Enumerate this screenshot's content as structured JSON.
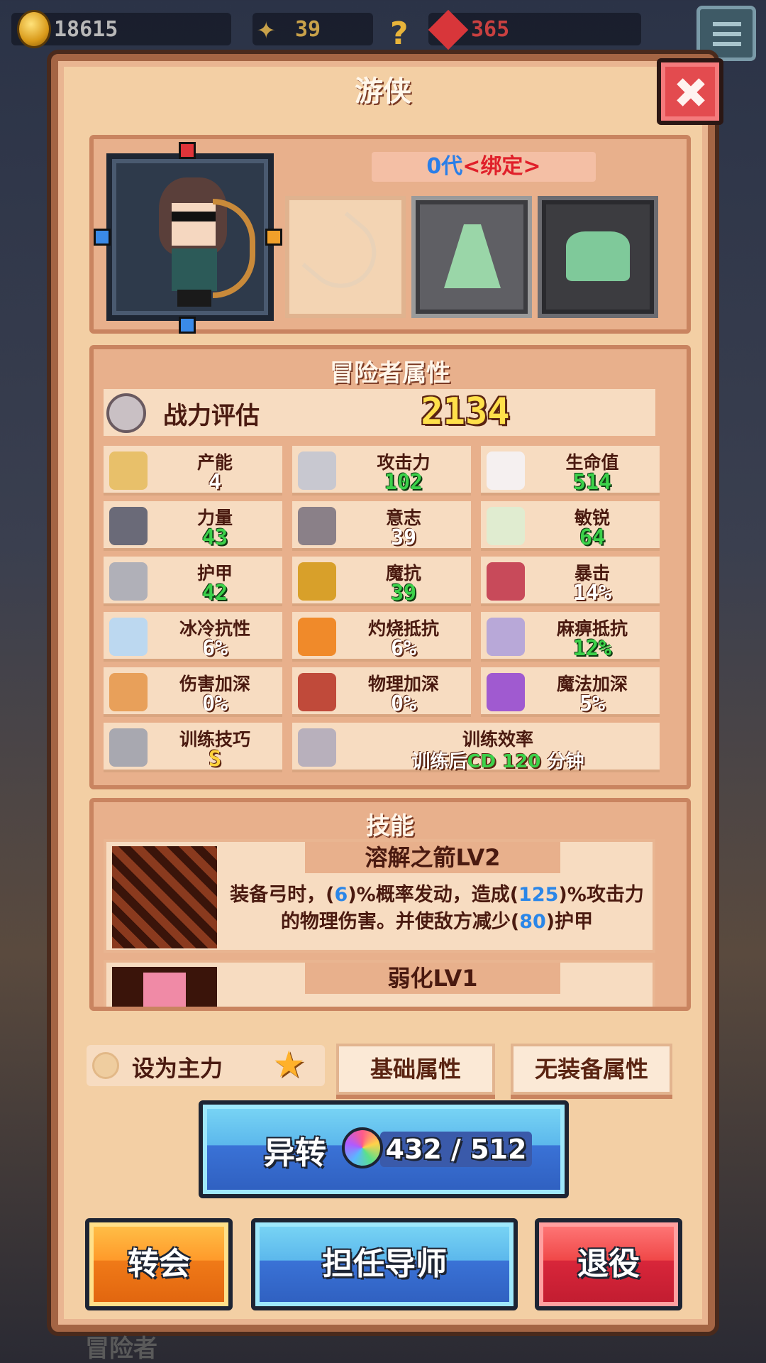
{
  "topbar": {
    "gold": "18615",
    "tokens": "39",
    "gems": "365",
    "gold_icon": "coin-icon",
    "token_icon": "feather-icon",
    "help_icon": "question-icon",
    "gem_icon": "ruby-icon",
    "menu_icon": "menu-icon"
  },
  "panel": {
    "title": "游侠",
    "close_icon": "close-icon"
  },
  "hero": {
    "generation_prefix": "0代",
    "bound_tag": "<绑定>",
    "equipment_slots": [
      "bow-icon",
      "cloak-icon",
      "boots-icon"
    ]
  },
  "attributes": {
    "title": "冒险者属性",
    "power_label": "战力评估",
    "power_value": "2134",
    "stats": [
      {
        "label": "产能",
        "value": "4",
        "style": "white",
        "icon": "crystal-icon"
      },
      {
        "label": "攻击力",
        "value": "102",
        "style": "green",
        "icon": "sword-icon"
      },
      {
        "label": "生命值",
        "value": "514",
        "style": "green",
        "icon": "cross-icon"
      },
      {
        "label": "力量",
        "value": "43",
        "style": "green",
        "icon": "gauntlet-icon"
      },
      {
        "label": "意志",
        "value": "39",
        "style": "white",
        "icon": "statue-icon"
      },
      {
        "label": "敏锐",
        "value": "64",
        "style": "green",
        "icon": "wing-icon"
      },
      {
        "label": "护甲",
        "value": "42",
        "style": "green",
        "icon": "shield-icon"
      },
      {
        "label": "魔抗",
        "value": "39",
        "style": "green",
        "icon": "magic-shield-icon"
      },
      {
        "label": "暴击",
        "value": "14%",
        "style": "white",
        "icon": "crossed-swords-icon"
      },
      {
        "label": "冰冷抗性",
        "value": "6%",
        "style": "white",
        "icon": "ice-icon"
      },
      {
        "label": "灼烧抵抗",
        "value": "6%",
        "style": "white",
        "icon": "fire-icon"
      },
      {
        "label": "麻痹抵抗",
        "value": "12%",
        "style": "green",
        "icon": "paralysis-icon"
      },
      {
        "label": "伤害加深",
        "value": "0%",
        "style": "white",
        "icon": "damage-icon"
      },
      {
        "label": "物理加深",
        "value": "0%",
        "style": "white",
        "icon": "heart-axe-icon"
      },
      {
        "label": "魔法加深",
        "value": "5%",
        "style": "white",
        "icon": "wand-icon"
      },
      {
        "label": "训练技巧",
        "value": "S",
        "style": "gold",
        "icon": "training-icon"
      }
    ],
    "training_efficiency": {
      "label": "训练效率",
      "prefix": "训练后",
      "cd": "CD 120",
      "suffix": "分钟",
      "icon": "swords-icon"
    }
  },
  "skills": {
    "title": "技能",
    "items": [
      {
        "name": "溶解之箭LV2",
        "icon": "arrow-skill-icon",
        "desc_1": "装备弓时，(",
        "n1": "6",
        "desc_2": ")%概率发动，造成(",
        "n2": "125",
        "desc_3": ")%攻击力的物理伤害。并使敌方减少(",
        "n3": "80",
        "desc_4": ")护甲"
      },
      {
        "name": "弱化LV1",
        "icon": "weaken-skill-icon"
      }
    ]
  },
  "controls": {
    "set_main_label": "设为主力",
    "star_icon": "star-icon",
    "base_attr_label": "基础属性",
    "no_equip_attr_label": "无装备属性",
    "transform_label": "异转",
    "transform_count": "432 / 512",
    "guild_label": "转会",
    "mentor_label": "担任导师",
    "retire_label": "退役"
  },
  "background": {
    "label": "冒险者"
  }
}
